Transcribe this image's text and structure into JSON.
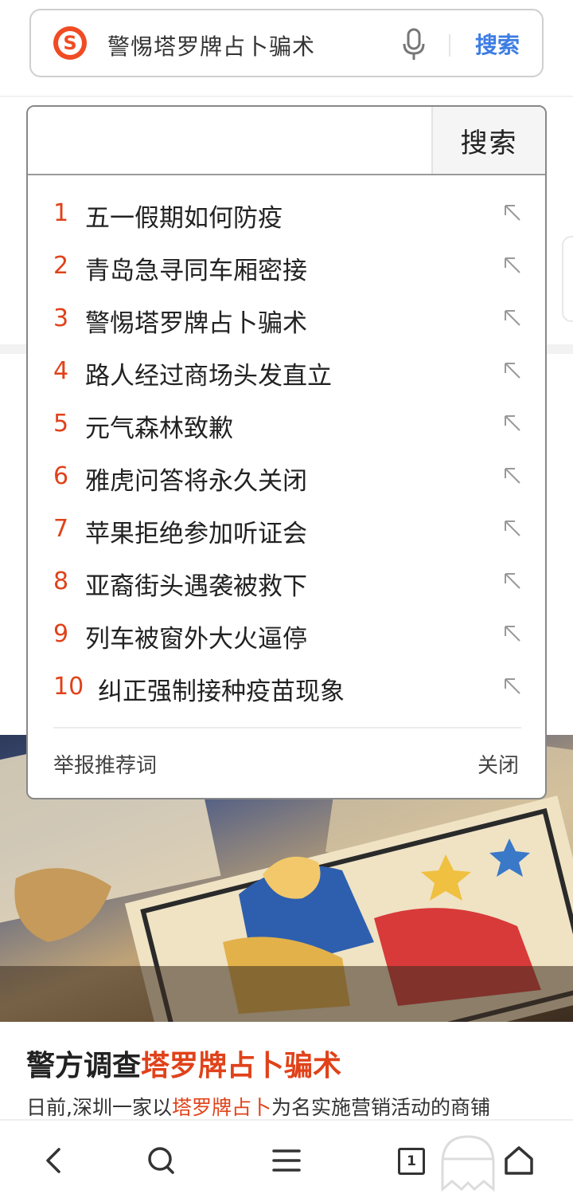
{
  "search": {
    "query": "警惕塔罗牌占卜骗术",
    "submit_label": "搜索",
    "logo_letter": "S"
  },
  "dropdown": {
    "input_value": "",
    "search_button_label": "搜索",
    "suggestions": [
      {
        "rank": "1",
        "text": "五一假期如何防疫"
      },
      {
        "rank": "2",
        "text": "青岛急寻同车厢密接"
      },
      {
        "rank": "3",
        "text": "警惕塔罗牌占卜骗术"
      },
      {
        "rank": "4",
        "text": "路人经过商场头发直立"
      },
      {
        "rank": "5",
        "text": "元气森林致歉"
      },
      {
        "rank": "6",
        "text": "雅虎问答将永久关闭"
      },
      {
        "rank": "7",
        "text": "苹果拒绝参加听证会"
      },
      {
        "rank": "8",
        "text": "亚裔街头遇袭被救下"
      },
      {
        "rank": "9",
        "text": "列车被窗外大火逼停"
      },
      {
        "rank": "10",
        "text": "纠正强制接种疫苗现象"
      }
    ],
    "report_label": "举报推荐词",
    "close_label": "关闭"
  },
  "article": {
    "title_prefix": "警方调查",
    "title_highlight": "塔罗牌占卜骗术",
    "snippet_prefix": "日前,深圳一家以",
    "snippet_highlight": "塔罗牌占卜",
    "snippet_suffix": "为名实施营销活动的商铺"
  },
  "bottom_nav": {
    "tab_count": "1"
  },
  "colors": {
    "accent_blue": "#3d7de4",
    "highlight_red": "#e0421a",
    "brand_orange": "#f04b23"
  }
}
